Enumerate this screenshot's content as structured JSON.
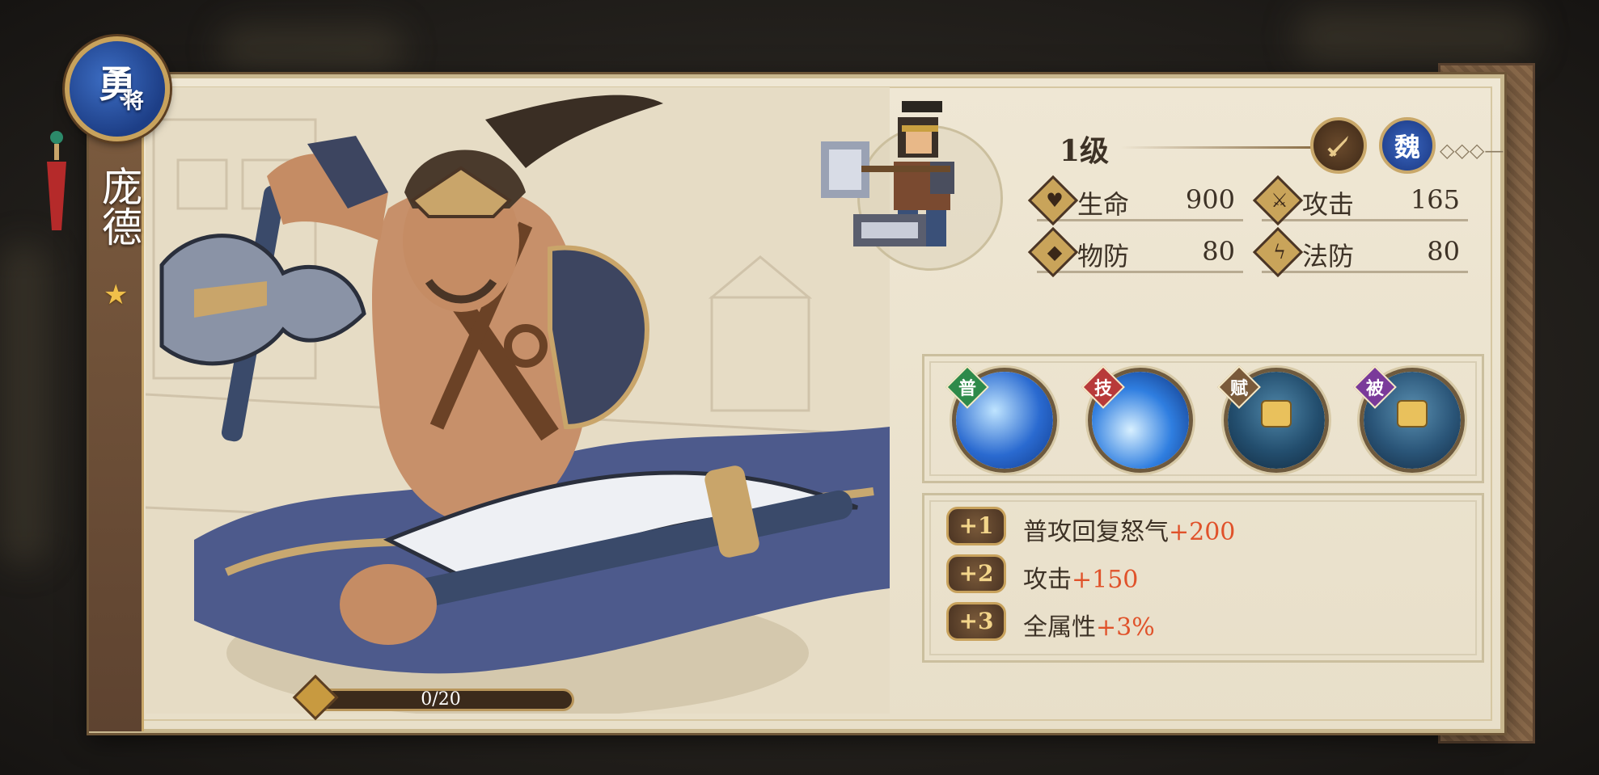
{
  "hero": {
    "rank_badge_char": "勇",
    "rank_badge_sub": "将",
    "name": "庞德",
    "stars": "★"
  },
  "exp": {
    "text": "0/20",
    "fraction": 0
  },
  "level": {
    "label": "1级",
    "class_icon": "sword-icon",
    "faction": "魏"
  },
  "stats": [
    {
      "icon": "heart-icon",
      "label": "生命",
      "value": "900"
    },
    {
      "icon": "sword-icon",
      "label": "攻击",
      "value": "165"
    },
    {
      "icon": "shield-icon",
      "label": "物防",
      "value": "80"
    },
    {
      "icon": "lightning-icon",
      "label": "法防",
      "value": "80"
    }
  ],
  "skills": [
    {
      "tag": "普",
      "tag_color": "#2e8a4a",
      "locked": false,
      "colors": [
        "#bfe4ff",
        "#2a6ad0",
        "#103a8a"
      ]
    },
    {
      "tag": "技",
      "tag_color": "#b83a3a",
      "locked": false,
      "colors": [
        "#d8f0ff",
        "#2f7ee0",
        "#0f2f78"
      ]
    },
    {
      "tag": "赋",
      "tag_color": "#7a5a3a",
      "locked": true,
      "colors": [
        "#4f86a8",
        "#234e6e",
        "#122a40"
      ]
    },
    {
      "tag": "被",
      "tag_color": "#7a3a9a",
      "locked": true,
      "colors": [
        "#5a8fb0",
        "#2a5578",
        "#142c44"
      ]
    }
  ],
  "bonuses": [
    {
      "badge": "+1",
      "text": "普攻回复怒气",
      "value": "+200"
    },
    {
      "badge": "+2",
      "text": "攻击",
      "value": "+150"
    },
    {
      "badge": "+3",
      "text": "全属性",
      "value": "+3%"
    }
  ],
  "colors": {
    "accent_red": "#e0522a",
    "panel_bg": "#efe7d4",
    "frame_brown": "#6e5638"
  }
}
